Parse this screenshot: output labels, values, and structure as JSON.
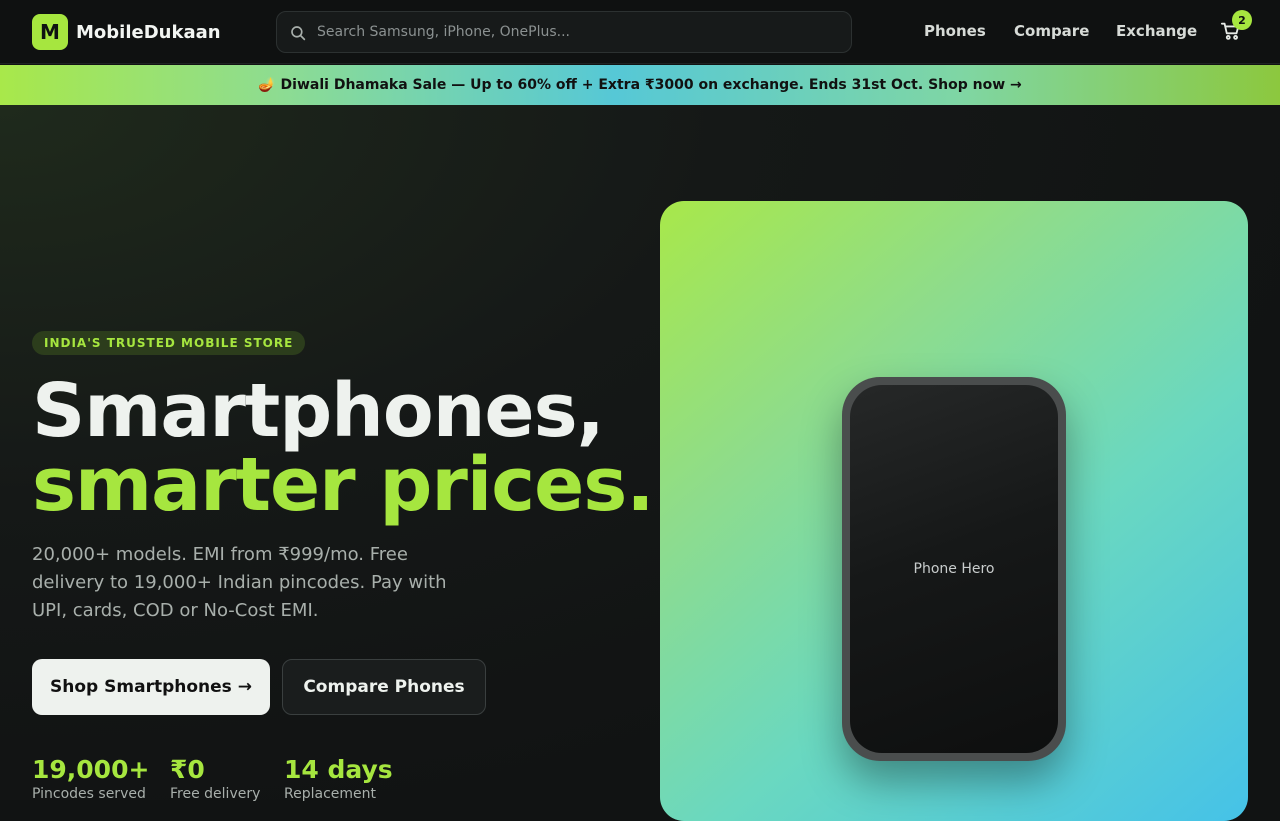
{
  "header": {
    "logo_letter": "M",
    "logo_text": "MobileDukaan",
    "search_placeholder": "Search Samsung, iPhone, OnePlus...",
    "nav": [
      "Phones",
      "Compare",
      "Exchange"
    ],
    "cart_count": "2"
  },
  "banner": {
    "text": "🪔 Diwali Dhamaka Sale — Up to 60% off + Extra ₹3000 on exchange. Ends 31st Oct. Shop now →"
  },
  "hero": {
    "tag": "INDIA'S TRUSTED MOBILE STORE",
    "headline_line1": "Smartphones,",
    "headline_line2": "smarter prices.",
    "description": "20,000+ models. EMI from ₹999/mo. Free delivery to 19,000+ Indian pincodes. Pay with UPI, cards, COD or No-Cost EMI.",
    "primary_cta": "Shop Smartphones →",
    "secondary_cta": "Compare Phones",
    "stats": [
      {
        "value": "19,000+",
        "label": "Pincodes served"
      },
      {
        "value": "₹0",
        "label": "Free delivery"
      },
      {
        "value": "14 days",
        "label": "Replacement"
      }
    ],
    "image_label": "Phone Hero"
  },
  "colors": {
    "accent": "#a6e63f",
    "background": "#111313"
  }
}
